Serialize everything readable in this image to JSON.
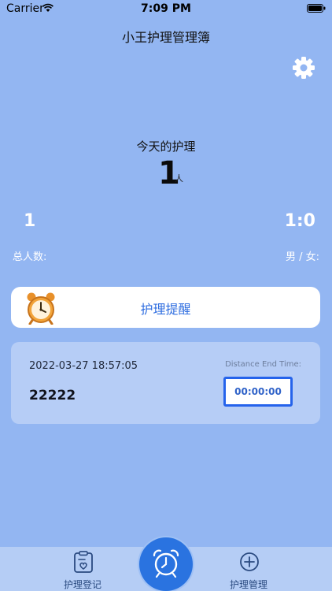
{
  "status_bar": {
    "carrier": "Carrier",
    "time": "7:09 PM"
  },
  "header": {
    "title": "小王护理管理簿"
  },
  "summary": {
    "today_label": "今天的护理",
    "today_count": "1",
    "today_unit": "人",
    "total_value": "1",
    "total_label": "总人数:",
    "ratio_value": "1:0",
    "ratio_label": "男 / 女:"
  },
  "reminder": {
    "label": "护理提醒"
  },
  "record": {
    "datetime": "2022-03-27 18:57:05",
    "name": "22222",
    "countdown_caption": "Distance End Time:",
    "countdown_value": "00:00:00"
  },
  "tab_bar": {
    "register_label": "护理登记",
    "manage_label": "护理管理"
  },
  "colors": {
    "background": "#93b6f2",
    "accent": "#2f6ee0",
    "center_button": "#2a73e0",
    "alarm_orange": "#f2a43a"
  }
}
